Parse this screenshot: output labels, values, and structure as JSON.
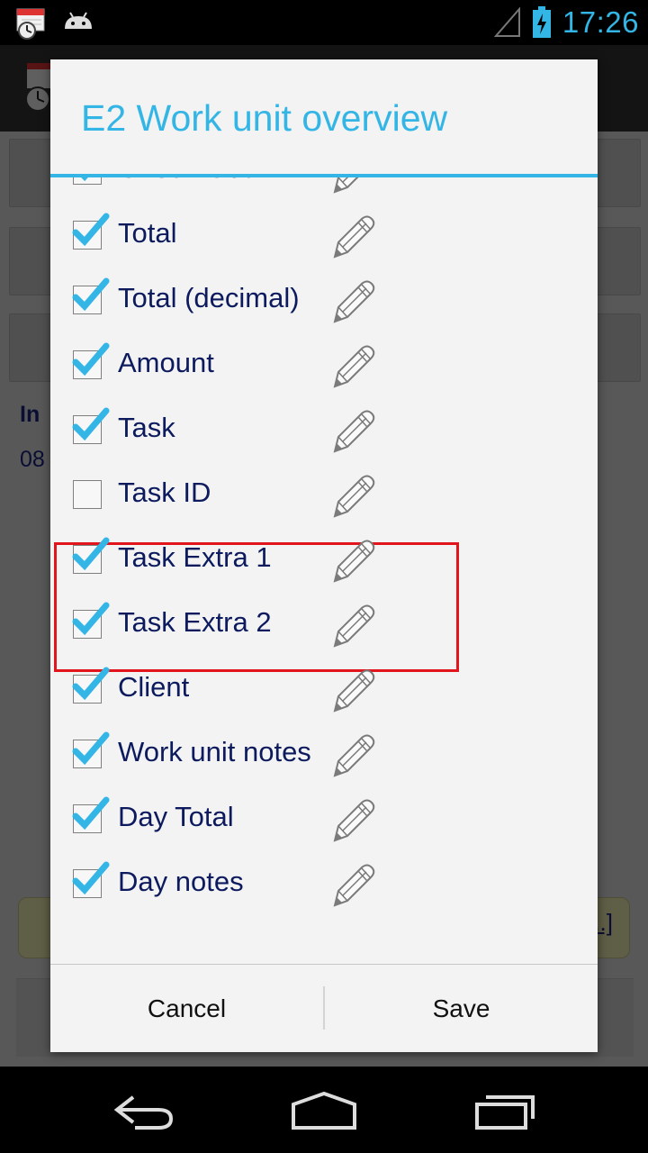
{
  "status_bar": {
    "time": "17:26",
    "icons_left": [
      "calendar-clock-app-icon",
      "android-icon"
    ],
    "icons_right": [
      "signal-icon",
      "battery-charging-icon"
    ]
  },
  "dialog": {
    "title": "E2 Work unit overview",
    "items": [
      {
        "label": "Check-Out",
        "checked": true
      },
      {
        "label": "Total",
        "checked": true
      },
      {
        "label": "Total (decimal)",
        "checked": true
      },
      {
        "label": "Amount",
        "checked": true
      },
      {
        "label": "Task",
        "checked": true
      },
      {
        "label": "Task ID",
        "checked": false
      },
      {
        "label": "Task Extra 1",
        "checked": true
      },
      {
        "label": "Task Extra 2",
        "checked": true
      },
      {
        "label": "Client",
        "checked": true
      },
      {
        "label": "Work unit notes",
        "checked": true
      },
      {
        "label": "Day Total",
        "checked": true
      },
      {
        "label": "Day notes",
        "checked": true
      }
    ],
    "cancel_label": "Cancel",
    "save_label": "Save"
  },
  "background": {
    "in_label": "In",
    "value_fragment": "08",
    "note_link_fragment": "..]"
  },
  "colors": {
    "accent": "#33b5e5",
    "label_text": "#0d1b5e",
    "highlight": "#e2141c"
  },
  "nav": [
    "back-icon",
    "home-icon",
    "recents-icon"
  ]
}
